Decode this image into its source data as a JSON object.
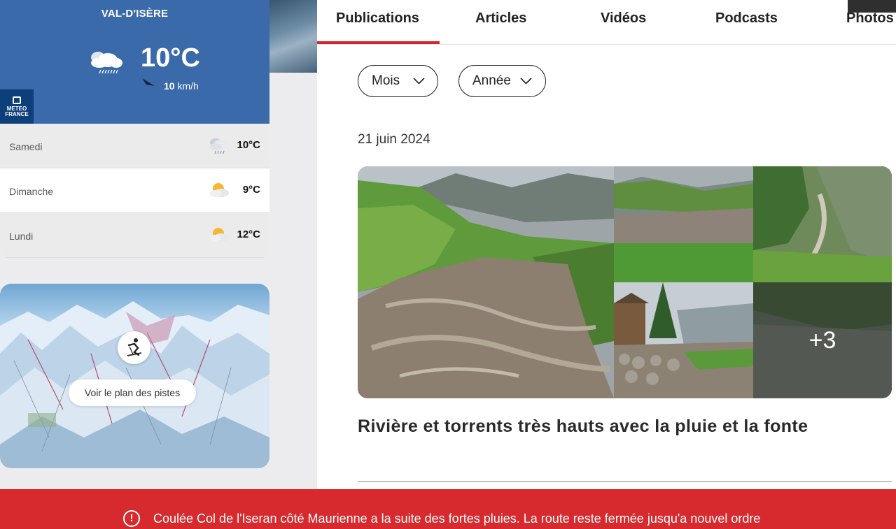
{
  "weather": {
    "location": "VAL-D'ISÈRE",
    "current_temp": "10°C",
    "current_icon": "rain-cloud-icon",
    "wind_speed": "10",
    "wind_unit": "km/h",
    "provider_line1": "METEO",
    "provider_line2": "FRANCE",
    "forecast": [
      {
        "day": "Samedi",
        "temp": "10°C",
        "icon": "rain-cloud-icon"
      },
      {
        "day": "Dimanche",
        "temp": "9°C",
        "icon": "sun-cloud-icon"
      },
      {
        "day": "Lundi",
        "temp": "12°C",
        "icon": "sun-cloud-icon"
      }
    ]
  },
  "ski_map": {
    "button_label": "Voir le plan des pistes",
    "icon": "skier-icon"
  },
  "tabs": [
    {
      "label": "Publications",
      "active": true
    },
    {
      "label": "Articles",
      "active": false
    },
    {
      "label": "Vidéos",
      "active": false
    },
    {
      "label": "Podcasts",
      "active": false
    },
    {
      "label": "Photos",
      "active": false
    }
  ],
  "filters": {
    "month": "Mois",
    "year": "Année"
  },
  "publication": {
    "date": "21 juin 2024",
    "more_photos": "+3",
    "title": "Rivière et torrents très hauts avec la pluie et la fonte"
  },
  "alert": {
    "icon": "!",
    "text": "Coulée Col de l'Iseran côté Maurienne a la suite des fortes pluies. La route reste fermée jusqu'a nouvel ordre"
  },
  "colors": {
    "brand_red": "#d6252b",
    "weather_blue": "#3a6aaa",
    "alert_red": "#d62a2e"
  }
}
